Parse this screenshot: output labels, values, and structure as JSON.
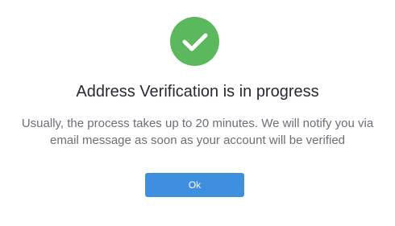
{
  "dialog": {
    "icon": "check-circle-icon",
    "icon_color": "#5cb85c",
    "title": "Address Verification is in progress",
    "message_line1": "Usually, the process takes up to 20 minutes. We will notify you via",
    "message_line2": "email message as soon as your account will be verified",
    "ok_label": "Ok",
    "ok_color": "#3f8fe1"
  }
}
